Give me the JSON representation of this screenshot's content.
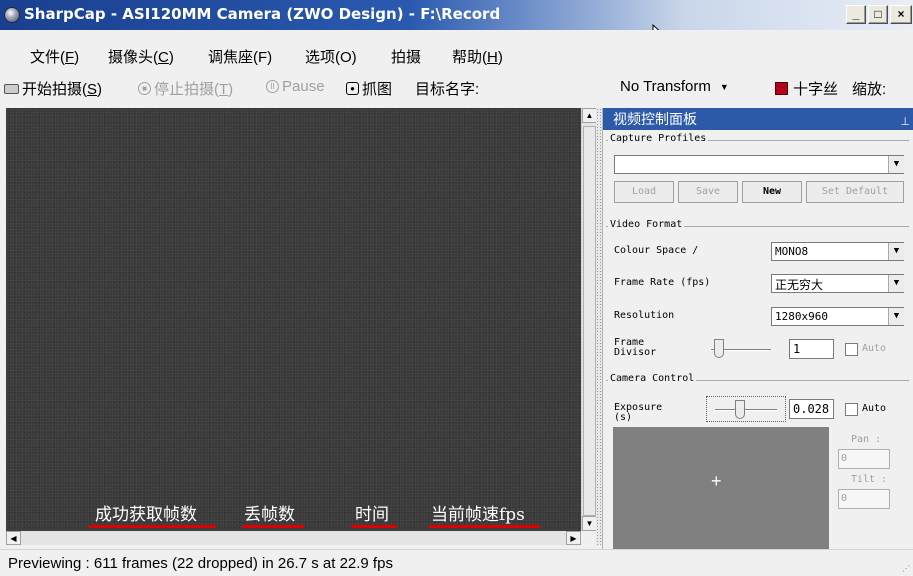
{
  "window": {
    "title": "SharpCap - ASI120MM Camera (ZWO Design) - F:\\Record",
    "minimize": "_",
    "maximize": "□",
    "close": "×"
  },
  "menu": {
    "file_prefix": "文件(",
    "file_key": "F",
    "file_suffix": ")",
    "camera_prefix": "摄像头(",
    "camera_key": "C",
    "camera_suffix": ")",
    "focuser": "调焦座(F)",
    "options": "选项(O)",
    "capture": "拍摄",
    "help_prefix": "帮助(",
    "help_key": "H",
    "help_suffix": ")"
  },
  "toolbar": {
    "start_prefix": "开始拍摄(",
    "start_key": "S",
    "start_suffix": ")",
    "stop_prefix": "停止拍摄(",
    "stop_key": "T",
    "stop_suffix": ")",
    "pause": "Pause",
    "snapshot": "抓图",
    "target_name": "目标名字:",
    "transform": "No Transform",
    "crosshair": "十字丝",
    "zoom": "缩放:"
  },
  "preview": {
    "annotations": [
      "成功获取帧数",
      "丢帧数",
      "时间",
      "当前帧速fps"
    ]
  },
  "status": {
    "text": "Previewing : 611 frames (22 dropped) in 26.7 s at 22.9 fps"
  },
  "panel": {
    "title": "视频控制面板",
    "capture_profiles": {
      "title": "Capture Profiles",
      "selected": "",
      "load": "Load",
      "save": "Save",
      "new": "New",
      "set_default": "Set Default"
    },
    "video_format": {
      "title": "Video Format",
      "colour_space_label": "Colour Space /",
      "colour_space_value": "MONO8",
      "frame_rate_label": "Frame Rate (fps)",
      "frame_rate_value": "正无穷大",
      "resolution_label": "Resolution",
      "resolution_value": "1280x960",
      "frame_divisor_label_1": "Frame",
      "frame_divisor_label_2": "Divisor",
      "frame_divisor_value": "1",
      "auto": "Auto"
    },
    "camera_control": {
      "title": "Camera Control",
      "exposure_label_1": "Exposure",
      "exposure_label_2": "(s)",
      "exposure_value": "0.028",
      "auto": "Auto",
      "pan_label": "Pan :",
      "pan_value": "0",
      "tilt_label": "Tilt :",
      "tilt_value": "0"
    }
  }
}
